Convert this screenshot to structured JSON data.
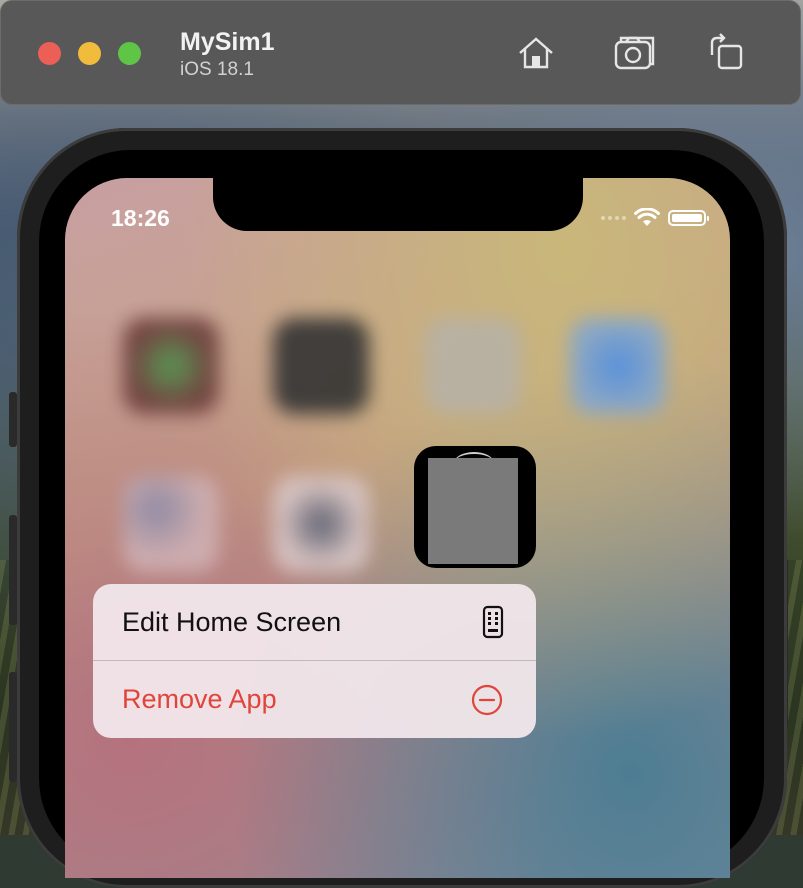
{
  "window": {
    "title": "MySim1",
    "subtitle": "iOS 18.1",
    "buttons": [
      "home-icon",
      "screenshot-icon",
      "rotate-icon"
    ]
  },
  "status_bar": {
    "time": "18:26",
    "icons": [
      "signal-dots-icon",
      "wifi-icon",
      "battery-icon"
    ]
  },
  "context_menu": {
    "items": [
      {
        "label": "Edit Home Screen",
        "icon": "phone-icon",
        "color": "#111111"
      },
      {
        "label": "Remove App",
        "icon": "minus-circle-icon",
        "color": "#e0443b"
      }
    ]
  }
}
